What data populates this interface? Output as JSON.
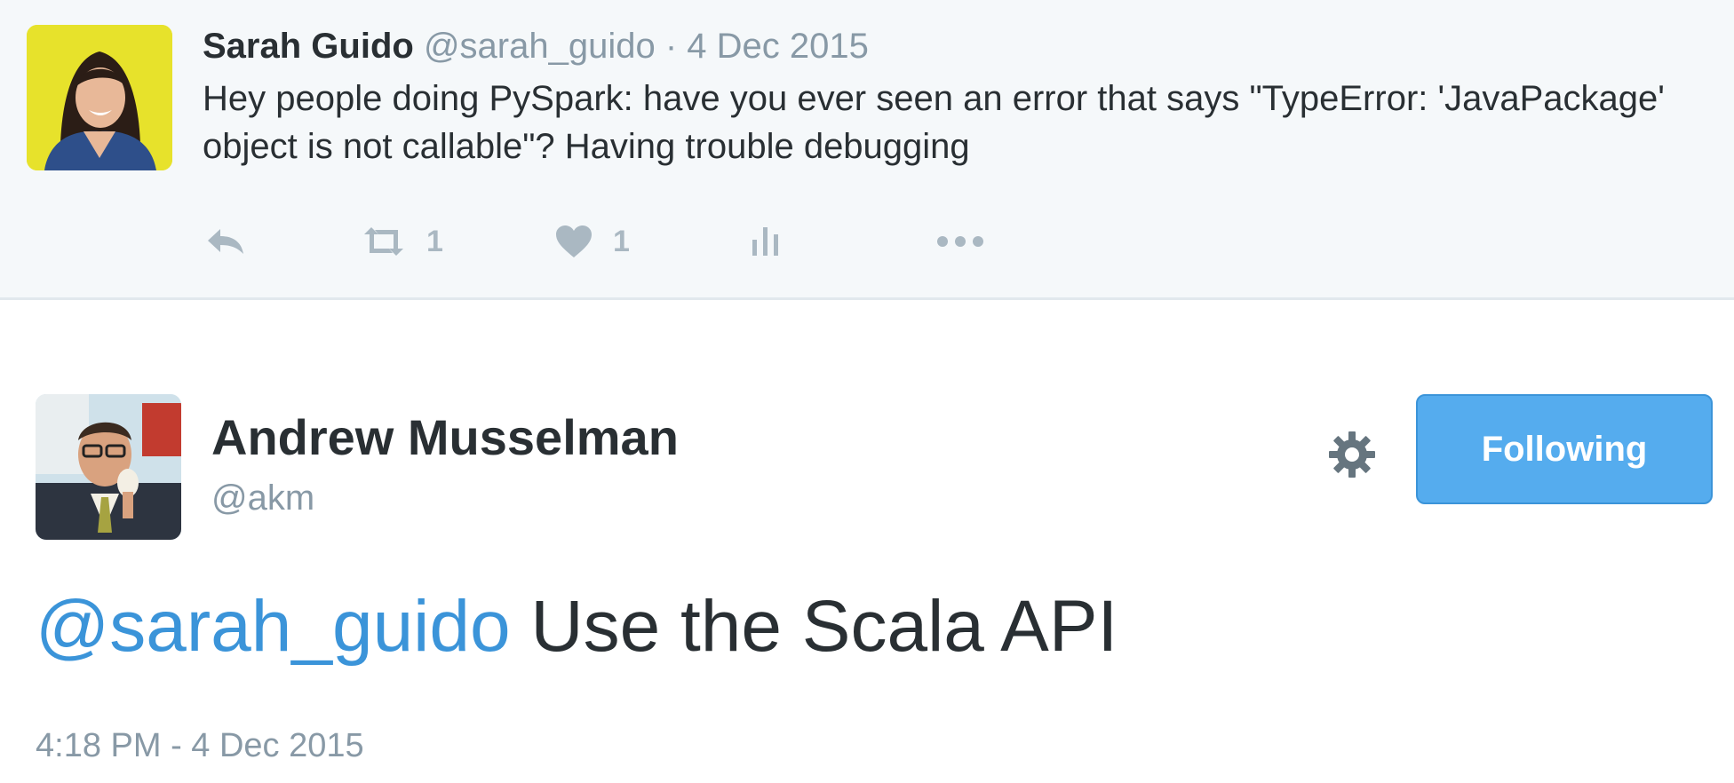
{
  "parent_tweet": {
    "author_name": "Sarah Guido",
    "author_handle": "@sarah_guido",
    "separator": "·",
    "date": "4 Dec 2015",
    "text": "Hey people doing PySpark: have you ever seen an error that says \"TypeError: 'JavaPackage' object is not callable\"? Having trouble debugging",
    "actions": {
      "reply_icon": "reply-icon",
      "retweet_icon": "retweet-icon",
      "retweet_count": "1",
      "like_icon": "heart-icon",
      "like_count": "1",
      "analytics_icon": "analytics-icon",
      "more_icon": "more-dots-icon"
    }
  },
  "main_tweet": {
    "author_name": "Andrew Musselman",
    "author_handle": "@akm",
    "follow_button_label": "Following",
    "settings_icon": "gear-icon",
    "mention": "@sarah_guido",
    "text": " Use the Scala API",
    "timestamp": "4:18 PM - 4 Dec 2015"
  },
  "colors": {
    "link": "#3b94d9",
    "button": "#55acee",
    "muted": "#8899a6",
    "text": "#292f33",
    "parent_bg": "#f5f8fa"
  }
}
